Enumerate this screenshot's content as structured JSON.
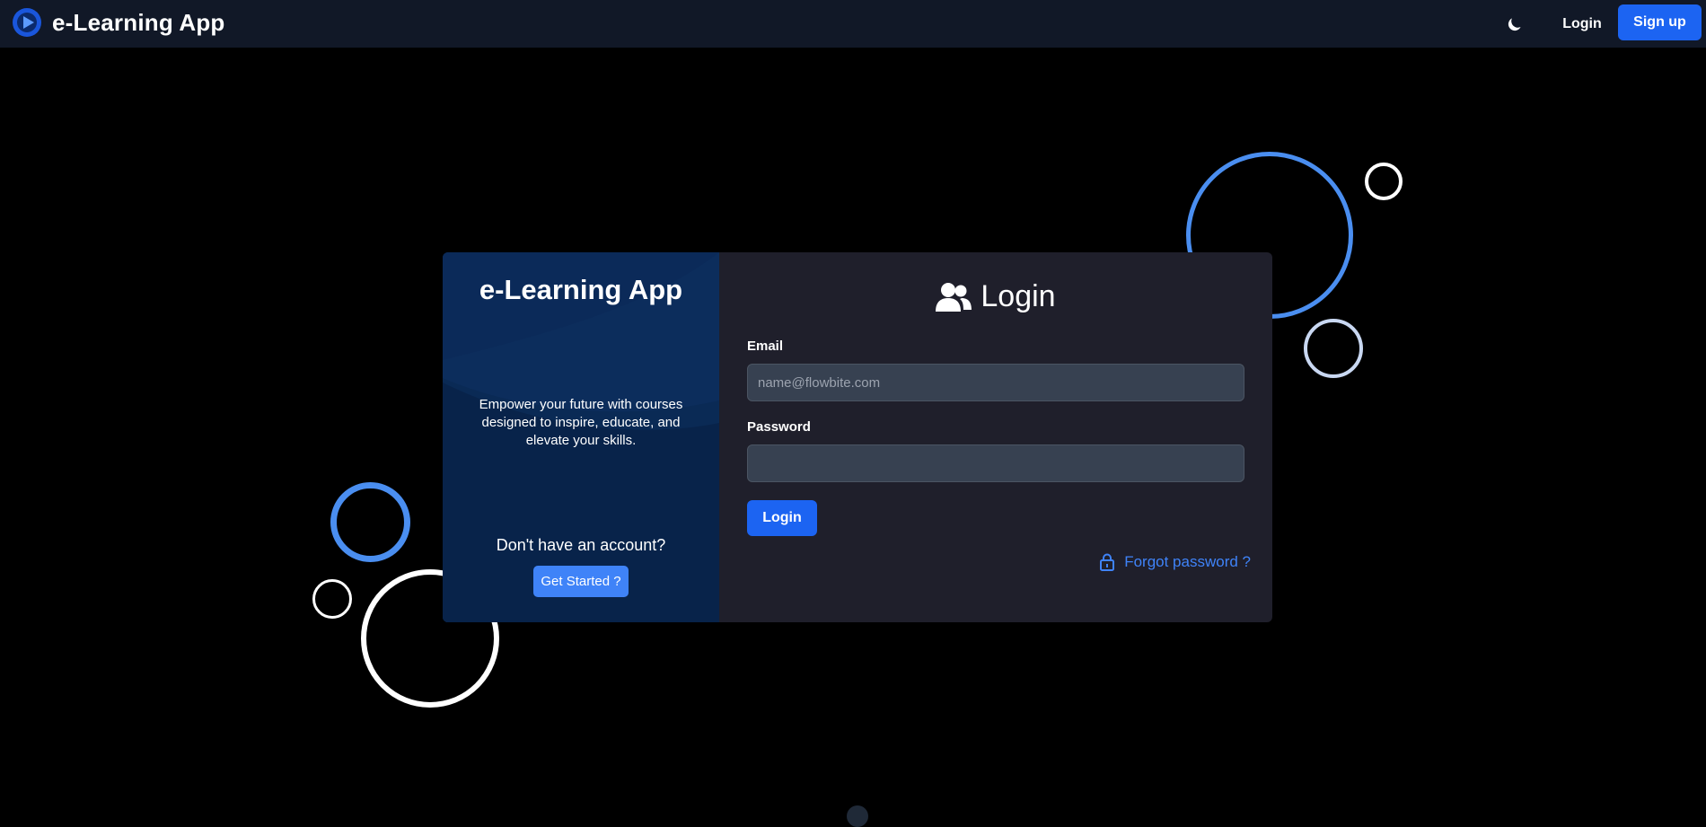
{
  "navbar": {
    "brand_name": "e-Learning App",
    "logo_icon": "play-logo-icon",
    "theme_icon": "moon-icon",
    "login_label": "Login",
    "signup_label": "Sign up"
  },
  "card": {
    "left": {
      "title": "e-Learning App",
      "tagline": "Empower your future with courses designed to inspire, educate, and elevate your skills.",
      "question": "Don't have an account?",
      "get_started_label": "Get Started ?"
    },
    "right": {
      "heading_icon": "users-icon",
      "heading": "Login",
      "email_label": "Email",
      "email_placeholder": "name@flowbite.com",
      "email_value": "",
      "password_label": "Password",
      "password_value": "",
      "login_button_label": "Login",
      "forgot_icon": "lock-icon",
      "forgot_label": "Forgot password ?"
    }
  },
  "colors": {
    "navbar_bg": "#111827",
    "page_bg": "#000000",
    "primary": "#1c64f2",
    "accent_blue": "#3f83f8",
    "card_left_bg": "#0a2750",
    "card_right_bg": "#1f1f2b",
    "input_bg": "#374151"
  }
}
